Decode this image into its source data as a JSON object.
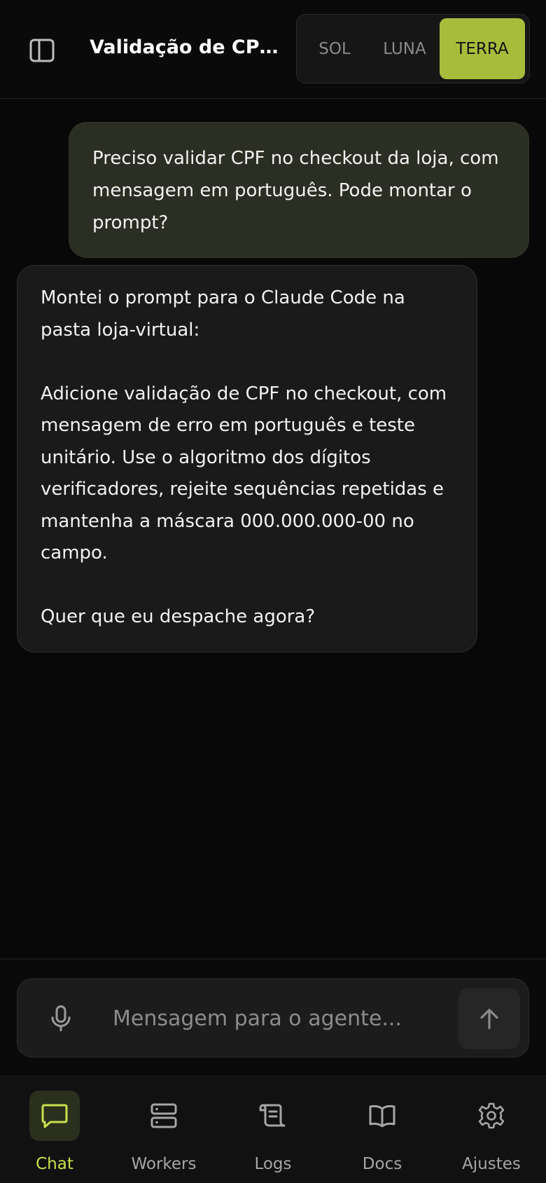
{
  "header": {
    "title": "Validação de CPF...",
    "segments": [
      {
        "label": "SOL",
        "active": false
      },
      {
        "label": "LUNA",
        "active": false
      },
      {
        "label": "TERRA",
        "active": true
      }
    ]
  },
  "messages": [
    {
      "role": "user",
      "text": "Preciso validar CPF no checkout da loja, com mensagem em português. Pode montar o prompt?"
    },
    {
      "role": "agent",
      "text": "Montei o prompt para o Claude Code na pasta loja-virtual:\n\nAdicione validação de CPF no checkout, com mensagem de erro em português e teste unitário. Use o algoritmo dos dígitos verificadores, rejeite sequências repetidas e mantenha a máscara 000.000.000-00 no campo.\n\nQuer que eu despache agora?"
    }
  ],
  "composer": {
    "placeholder": "Mensagem para o agente...",
    "value": "",
    "mic_icon": "mic-icon",
    "send_icon": "arrow-up-icon"
  },
  "nav": {
    "items": [
      {
        "label": "Chat",
        "icon": "chat-bubble-icon",
        "active": true
      },
      {
        "label": "Workers",
        "icon": "server-icon",
        "active": false
      },
      {
        "label": "Logs",
        "icon": "scroll-icon",
        "active": false
      },
      {
        "label": "Docs",
        "icon": "book-icon",
        "active": false
      },
      {
        "label": "Ajustes",
        "icon": "gear-icon",
        "active": false
      }
    ]
  },
  "colors": {
    "accent": "#a8bc3c",
    "accent_text": "#c8e24c",
    "background": "#080808",
    "user_bubble": "#2b2e22",
    "agent_bubble": "#1a1a1a"
  }
}
